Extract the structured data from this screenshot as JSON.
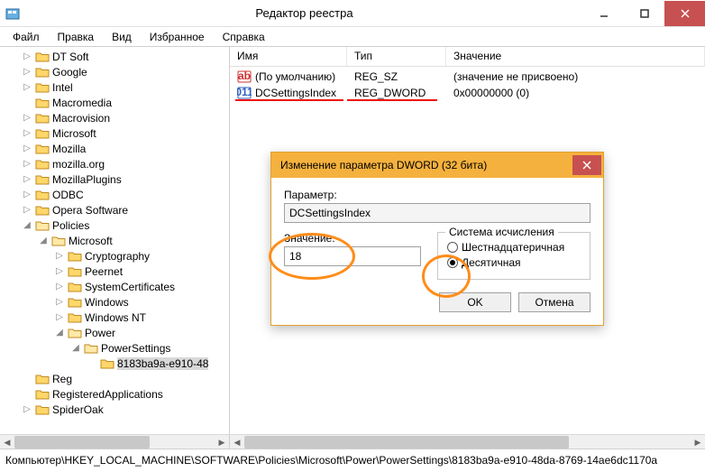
{
  "window": {
    "title": "Редактор реестра"
  },
  "menu": {
    "file": "Файл",
    "edit": "Правка",
    "view": "Вид",
    "favorites": "Избранное",
    "help": "Справка"
  },
  "tree": {
    "items": [
      {
        "label": "DT Soft",
        "indent": 1,
        "expander": "▷"
      },
      {
        "label": "Google",
        "indent": 1,
        "expander": "▷"
      },
      {
        "label": "Intel",
        "indent": 1,
        "expander": "▷"
      },
      {
        "label": "Macromedia",
        "indent": 1,
        "expander": ""
      },
      {
        "label": "Macrovision",
        "indent": 1,
        "expander": "▷"
      },
      {
        "label": "Microsoft",
        "indent": 1,
        "expander": "▷"
      },
      {
        "label": "Mozilla",
        "indent": 1,
        "expander": "▷"
      },
      {
        "label": "mozilla.org",
        "indent": 1,
        "expander": "▷"
      },
      {
        "label": "MozillaPlugins",
        "indent": 1,
        "expander": "▷"
      },
      {
        "label": "ODBC",
        "indent": 1,
        "expander": "▷"
      },
      {
        "label": "Opera Software",
        "indent": 1,
        "expander": "▷"
      },
      {
        "label": "Policies",
        "indent": 1,
        "expander": "◢"
      },
      {
        "label": "Microsoft",
        "indent": 2,
        "expander": "◢"
      },
      {
        "label": "Cryptography",
        "indent": 3,
        "expander": "▷"
      },
      {
        "label": "Peernet",
        "indent": 3,
        "expander": "▷"
      },
      {
        "label": "SystemCertificates",
        "indent": 3,
        "expander": "▷"
      },
      {
        "label": "Windows",
        "indent": 3,
        "expander": "▷"
      },
      {
        "label": "Windows NT",
        "indent": 3,
        "expander": "▷"
      },
      {
        "label": "Power",
        "indent": 3,
        "expander": "◢"
      },
      {
        "label": "PowerSettings",
        "indent": 4,
        "expander": "◢"
      },
      {
        "label": "8183ba9a-e910-48",
        "indent": 5,
        "expander": "",
        "selected": true
      },
      {
        "label": "Reg",
        "indent": 1,
        "expander": ""
      },
      {
        "label": "RegisteredApplications",
        "indent": 1,
        "expander": ""
      },
      {
        "label": "SpiderOak",
        "indent": 1,
        "expander": "▷"
      }
    ]
  },
  "list": {
    "headers": {
      "name": "Имя",
      "type": "Тип",
      "value": "Значение"
    },
    "rows": [
      {
        "icon": "ab",
        "name": "(По умолчанию)",
        "type": "REG_SZ",
        "value": "(значение не присвоено)"
      },
      {
        "icon": "bin",
        "name": "DCSettingsIndex",
        "type": "REG_DWORD",
        "value": "0x00000000 (0)"
      }
    ]
  },
  "dialog": {
    "title": "Изменение параметра DWORD (32 бита)",
    "param_label": "Параметр:",
    "param_value": "DCSettingsIndex",
    "value_label": "Значение:",
    "value_input": "18",
    "base_group": "Система исчисления",
    "radio_hex": "Шестнадцатеричная",
    "radio_dec": "Десятичная",
    "ok": "OK",
    "cancel": "Отмена"
  },
  "statusbar": {
    "path": "Компьютер\\HKEY_LOCAL_MACHINE\\SOFTWARE\\Policies\\Microsoft\\Power\\PowerSettings\\8183ba9a-e910-48da-8769-14ae6dc1170a"
  }
}
